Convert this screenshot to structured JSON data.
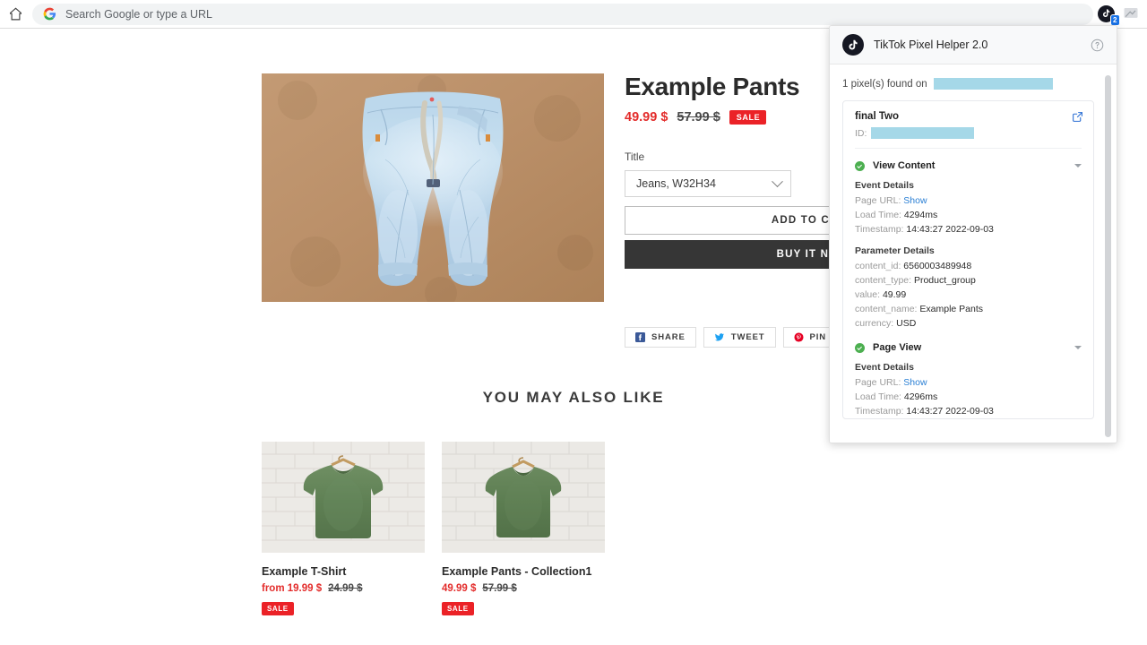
{
  "browser": {
    "home_icon": "home-icon",
    "google_icon": "google-g-icon",
    "omnibox_placeholder": "Search Google or type a URL",
    "omnibox_value": "",
    "extension_badge_count": "2"
  },
  "product": {
    "title": "Example Pants",
    "price_current": "49.99 $",
    "price_compare": "57.99 $",
    "sale_label": "SALE",
    "variant_label": "Title",
    "variant_selected": "Jeans, W32H34",
    "add_to_cart_label": "ADD TO CART",
    "buy_now_label": "BUY IT NOW",
    "share_buttons": [
      {
        "label": "SHARE",
        "icon": "facebook-icon",
        "color": "#3b5998"
      },
      {
        "label": "TWEET",
        "icon": "twitter-icon",
        "color": "#1da1f2"
      },
      {
        "label": "PIN IT",
        "icon": "pinterest-icon",
        "color": "#e60023"
      }
    ]
  },
  "recommendations": {
    "heading": "YOU MAY ALSO LIKE",
    "items": [
      {
        "name": "Example T-Shirt",
        "price_current": "from 19.99 $",
        "price_compare": "24.99 $",
        "sale_label": "SALE"
      },
      {
        "name": "Example Pants - Collection1",
        "price_current": "49.99 $",
        "price_compare": "57.99 $",
        "sale_label": "SALE"
      }
    ]
  },
  "pixel_helper": {
    "header_title": "TikTok Pixel Helper 2.0",
    "help_icon": "question-circle-icon",
    "logo_icon": "tiktok-note-icon",
    "found_text": "1 pixel(s) found on",
    "found_redacted": true,
    "pixel": {
      "name": "final Two",
      "id_label": "ID:",
      "id_redacted": true,
      "open_icon": "external-link-icon"
    },
    "events": [
      {
        "name": "View Content",
        "status_icon": "check-circle-icon",
        "collapse_icon": "chevron-down-icon",
        "event_details_title": "Event Details",
        "event_details": [
          {
            "key": "Page URL:",
            "value": "Show",
            "is_link": true
          },
          {
            "key": "Load Time:",
            "value": "4294ms",
            "is_link": false
          },
          {
            "key": "Timestamp:",
            "value": "14:43:27 2022-09-03",
            "is_link": false
          }
        ],
        "parameter_details_title": "Parameter Details",
        "parameter_details": [
          {
            "key": "content_id:",
            "value": "6560003489948"
          },
          {
            "key": "content_type:",
            "value": "Product_group"
          },
          {
            "key": "value:",
            "value": "49.99"
          },
          {
            "key": "content_name:",
            "value": "Example Pants"
          },
          {
            "key": "currency:",
            "value": "USD"
          }
        ]
      },
      {
        "name": "Page View",
        "status_icon": "check-circle-icon",
        "collapse_icon": "chevron-down-icon",
        "event_details_title": "Event Details",
        "event_details": [
          {
            "key": "Page URL:",
            "value": "Show",
            "is_link": true
          },
          {
            "key": "Load Time:",
            "value": "4296ms",
            "is_link": false
          },
          {
            "key": "Timestamp:",
            "value": "14:43:27 2022-09-03",
            "is_link": false
          }
        ],
        "parameter_details_title": "",
        "parameter_details": []
      }
    ]
  },
  "colors": {
    "sale_red": "#eb2227",
    "price_red": "#e32c2b",
    "redaction_blue": "#a5d8e8",
    "status_green": "#4caf50",
    "link_blue": "#2a7fd4",
    "buy_now_dark": "#363636"
  }
}
